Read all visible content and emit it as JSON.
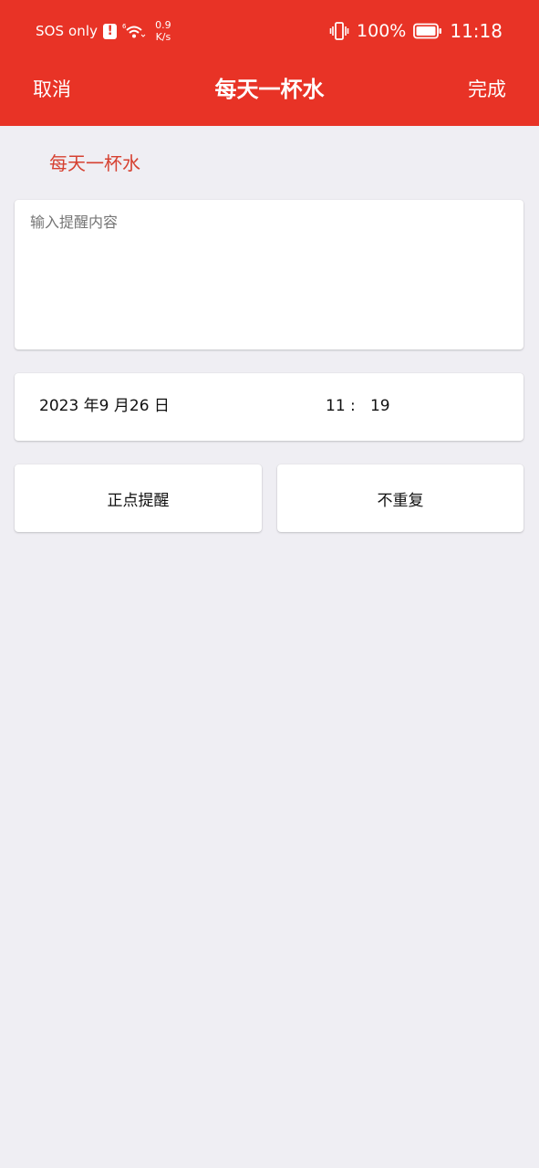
{
  "status_bar": {
    "carrier": "SOS only",
    "alert_symbol": "!",
    "wifi_icon": "wifi-6-icon",
    "net_speed_value": "0.9",
    "net_speed_unit": "K/s",
    "vibrate_icon": "vibrate-icon",
    "battery_percent": "100%",
    "battery_level": 1.0,
    "time": "11:18"
  },
  "nav": {
    "cancel_label": "取消",
    "title": "每天一杯水",
    "done_label": "完成"
  },
  "form": {
    "subtitle": "每天一杯水",
    "content_placeholder": "输入提醒内容",
    "content_value": "",
    "date": "2023 年9 月26 日",
    "time": "11 :   19",
    "remind_option": "正点提醒",
    "repeat_option": "不重复"
  },
  "colors": {
    "accent": "#e83326",
    "subtitle": "#d64030",
    "background": "#efeef3",
    "card": "#ffffff"
  }
}
